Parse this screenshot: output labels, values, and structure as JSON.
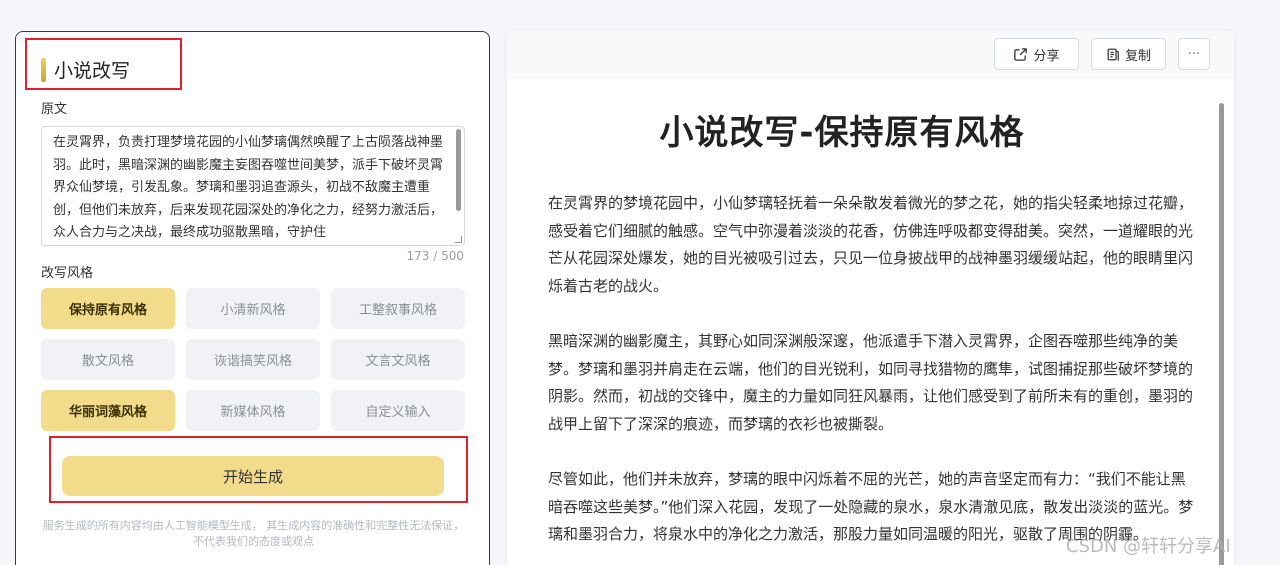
{
  "left": {
    "title": "小说改写",
    "original_label": "原文",
    "original_text": "在灵霄界，负责打理梦境花园的小仙梦璃偶然唤醒了上古陨落战神墨羽。此时，黑暗深渊的幽影魔主妄图吞噬世间美梦，派手下破坏灵霄界众仙梦境，引发乱象。梦璃和墨羽追查源头，初战不敌魔主遭重创，但他们未放弃，后来发现花园深处的净化之力，经努力激活后，众人合力与之决战，最终成功驱散黑暗，守护住",
    "char_count": "173 / 500",
    "style_label": "改写风格",
    "styles": [
      {
        "label": "保持原有风格",
        "active": true
      },
      {
        "label": "小清新风格",
        "active": false
      },
      {
        "label": "工整叙事风格",
        "active": false
      },
      {
        "label": "散文风格",
        "active": false
      },
      {
        "label": "诙谐搞笑风格",
        "active": false
      },
      {
        "label": "文言文风格",
        "active": false
      },
      {
        "label": "华丽词藻风格",
        "active": true
      },
      {
        "label": "新媒体风格",
        "active": false
      },
      {
        "label": "自定义输入",
        "active": false
      }
    ],
    "generate_label": "开始生成",
    "disclaimer": "服务生成的所有内容均由人工智能模型生成， 其生成内容的准确性和完整性无法保证， 不代表我们的态度或观点"
  },
  "right": {
    "share_label": "分享",
    "copy_label": "复制",
    "more_label": "···",
    "doc_title": "小说改写-保持原有风格",
    "paragraphs": [
      "在灵霄界的梦境花园中，小仙梦璃轻抚着一朵朵散发着微光的梦之花，她的指尖轻柔地掠过花瓣，感受着它们细腻的触感。空气中弥漫着淡淡的花香，仿佛连呼吸都变得甜美。突然，一道耀眼的光芒从花园深处爆发，她的目光被吸引过去，只见一位身披战甲的战神墨羽缓缓站起，他的眼睛里闪烁着古老的战火。",
      "黑暗深渊的幽影魔主，其野心如同深渊般深邃，他派遣手下潜入灵霄界，企图吞噬那些纯净的美梦。梦璃和墨羽并肩走在云端，他们的目光锐利，如同寻找猎物的鹰隼，试图捕捉那些破坏梦境的阴影。然而，初战的交锋中，魔主的力量如同狂风暴雨，让他们感受到了前所未有的重创，墨羽的战甲上留下了深深的痕迹，而梦璃的衣衫也被撕裂。",
      "尽管如此，他们并未放弃，梦璃的眼中闪烁着不屈的光芒，她的声音坚定而有力：“我们不能让黑暗吞噬这些美梦。”他们深入花园，发现了一处隐藏的泉水，泉水清澈见底，散发出淡淡的蓝光。梦璃和墨羽合力，将泉水中的净化之力激活，那股力量如同温暖的阳光，驱散了周围的阴霾。"
    ]
  },
  "watermark": "CSDN @轩轩分享AI"
}
